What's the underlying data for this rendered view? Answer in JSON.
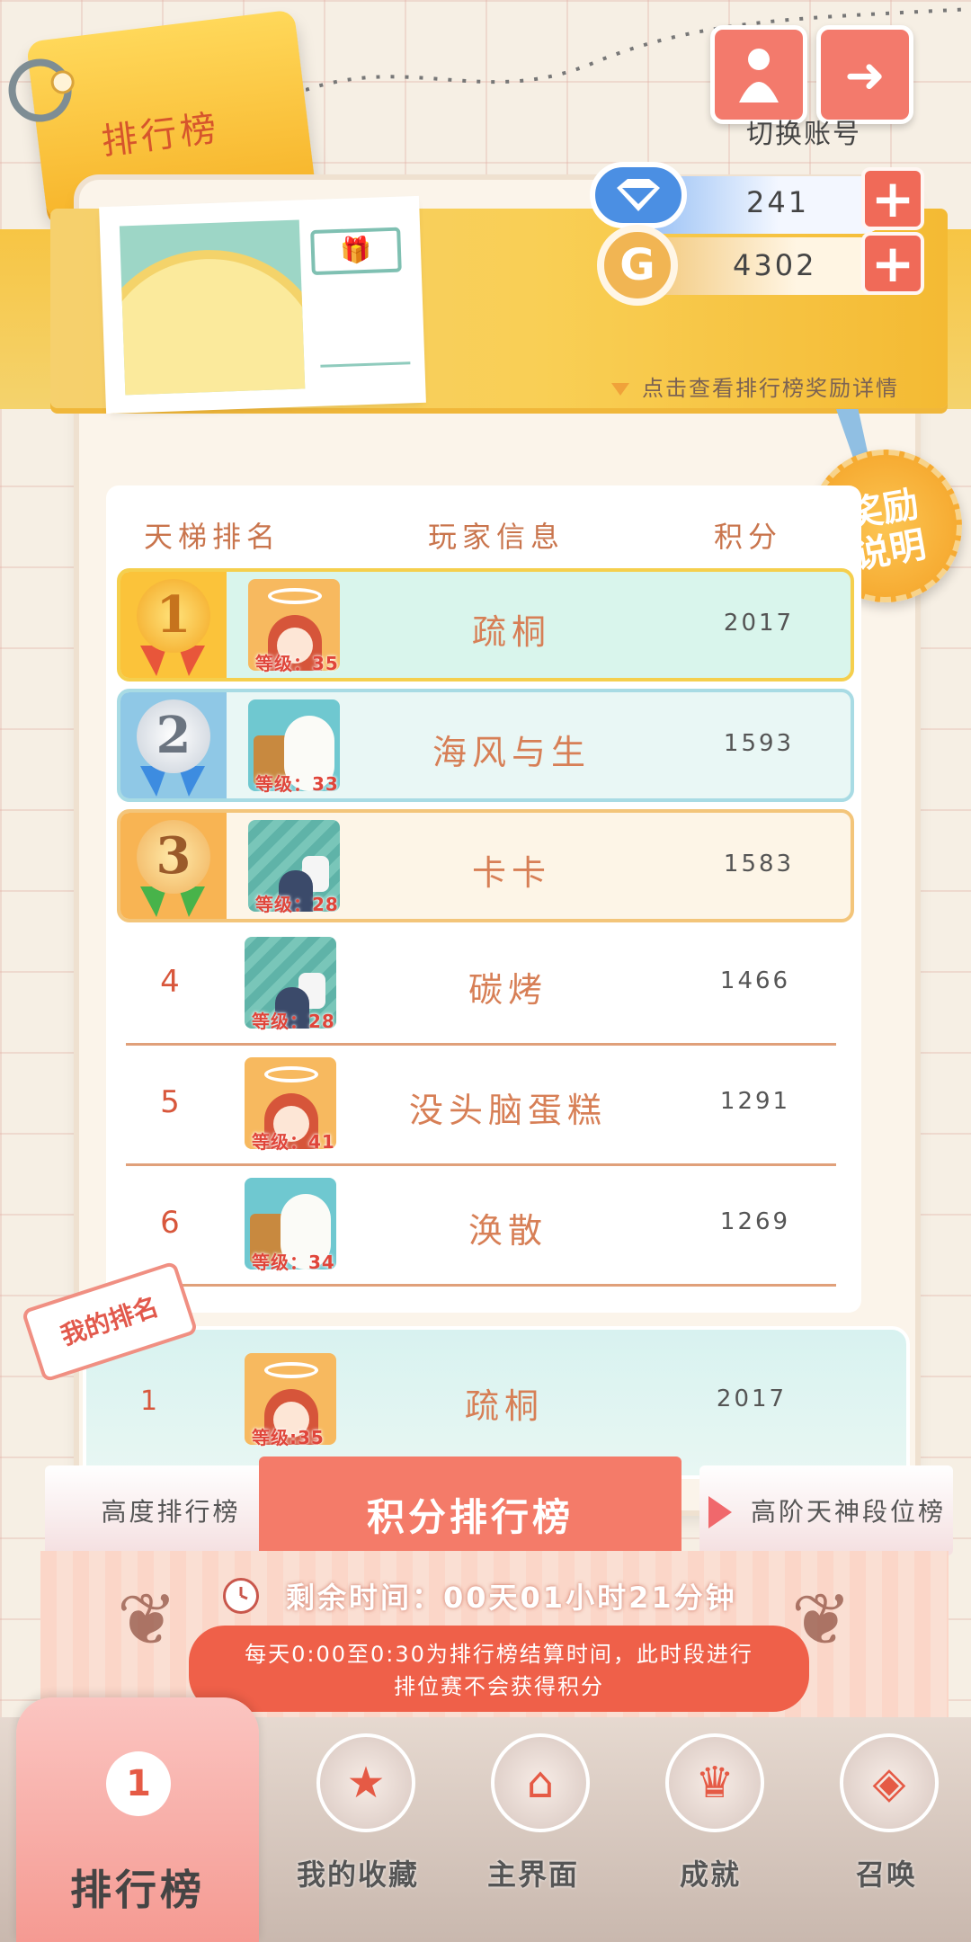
{
  "header": {
    "title": "排行榜",
    "switch_account": "切换账号"
  },
  "currency": {
    "gems": "241",
    "gold": "4302",
    "gold_letter": "G",
    "plus": "+"
  },
  "banner": {
    "reward_link": "点击查看排行榜奖励详情"
  },
  "reward_medal": {
    "line1": "奖励",
    "line2": "说明"
  },
  "table": {
    "headers": [
      "天梯排名",
      "玩家信息",
      "积分"
    ],
    "rows": [
      {
        "rank": "1",
        "name": "疏桐",
        "level": "等级：35",
        "score": "2017"
      },
      {
        "rank": "2",
        "name": "海风与生",
        "level": "等级：33",
        "score": "1593"
      },
      {
        "rank": "3",
        "name": "卡卡",
        "level": "等级：28",
        "score": "1583"
      },
      {
        "rank": "4",
        "name": "碳烤",
        "level": "等级：28",
        "score": "1466"
      },
      {
        "rank": "5",
        "name": "没头脑蛋糕",
        "level": "等级：41",
        "score": "1291"
      },
      {
        "rank": "6",
        "name": "涣散",
        "level": "等级：34",
        "score": "1269"
      }
    ]
  },
  "my_rank": {
    "tag": "我的排名",
    "rank": "1",
    "name": "疏桐",
    "level": "等级:35",
    "score": "2017"
  },
  "tabs": {
    "left": "高度排行榜",
    "active": "积分排行榜",
    "right": "高阶天神段位榜"
  },
  "timer": {
    "remaining": "剩余时间：00天01小时21分钟",
    "notice_line1": "每天0:00至0:30为排行榜结算时间，此时段进行",
    "notice_line2": "排位赛不会获得积分"
  },
  "nav": {
    "active_label": "排行榜",
    "active_icon_text": "1",
    "items": [
      {
        "label": "我的收藏",
        "icon": "star-icon"
      },
      {
        "label": "主界面",
        "icon": "home-icon"
      },
      {
        "label": "成就",
        "icon": "trophy-icon"
      },
      {
        "label": "召唤",
        "icon": "summon-icon"
      }
    ]
  },
  "colors": {
    "accent": "#f47b69",
    "gold": "#f7b52b",
    "rank_text": "#d8573c"
  }
}
